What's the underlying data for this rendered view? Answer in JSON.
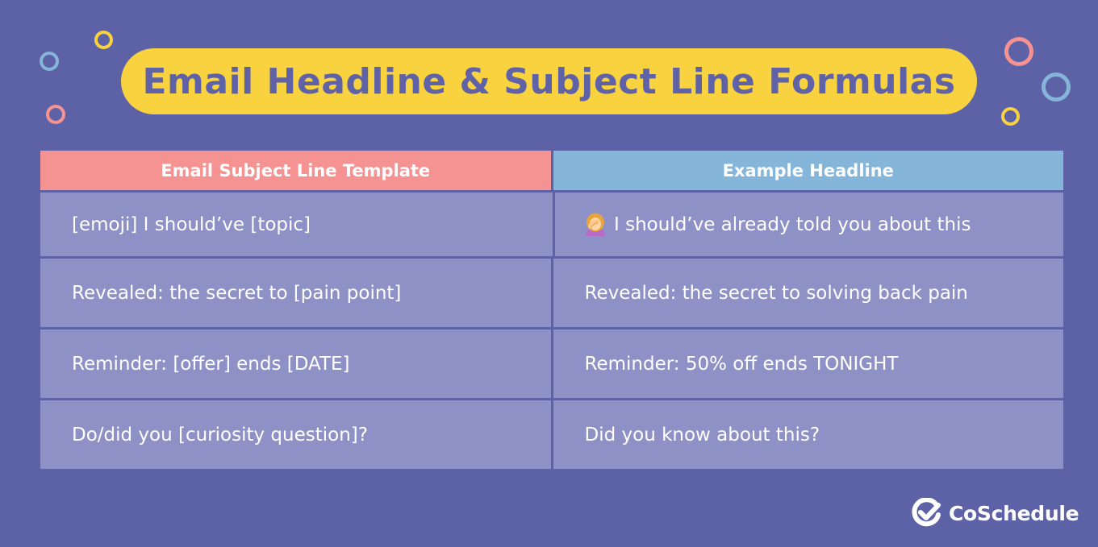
{
  "title": "Email Headline & Subject Line Formulas",
  "table": {
    "headers": [
      "Email Subject Line Template",
      "Example Headline"
    ],
    "rows": [
      {
        "template": "[emoji] I should’ve [topic]",
        "example": "I should’ve already told you about this",
        "example_icon": "facepalm-emoji-icon"
      },
      {
        "template": "Revealed: the secret to [pain point]",
        "example": "Revealed: the secret to solving back pain"
      },
      {
        "template": "Reminder: [offer] ends [DATE]",
        "example": "Reminder: 50% off ends TONIGHT"
      },
      {
        "template": "Do/did you [curiosity question]?",
        "example": "Did you know about this?"
      }
    ]
  },
  "brand": {
    "name": "CoSchedule",
    "logo_icon": "checkmark-logo-icon"
  },
  "colors": {
    "background": "#5d62a7",
    "title_pill": "#f8d33f",
    "title_text": "#5f62a6",
    "header_left": "#f49392",
    "header_right": "#85b5d8",
    "cell": "#8e91c5",
    "ring_yellow": "#f8d33f",
    "ring_blue": "#85b5d8",
    "ring_pink": "#f49392"
  }
}
